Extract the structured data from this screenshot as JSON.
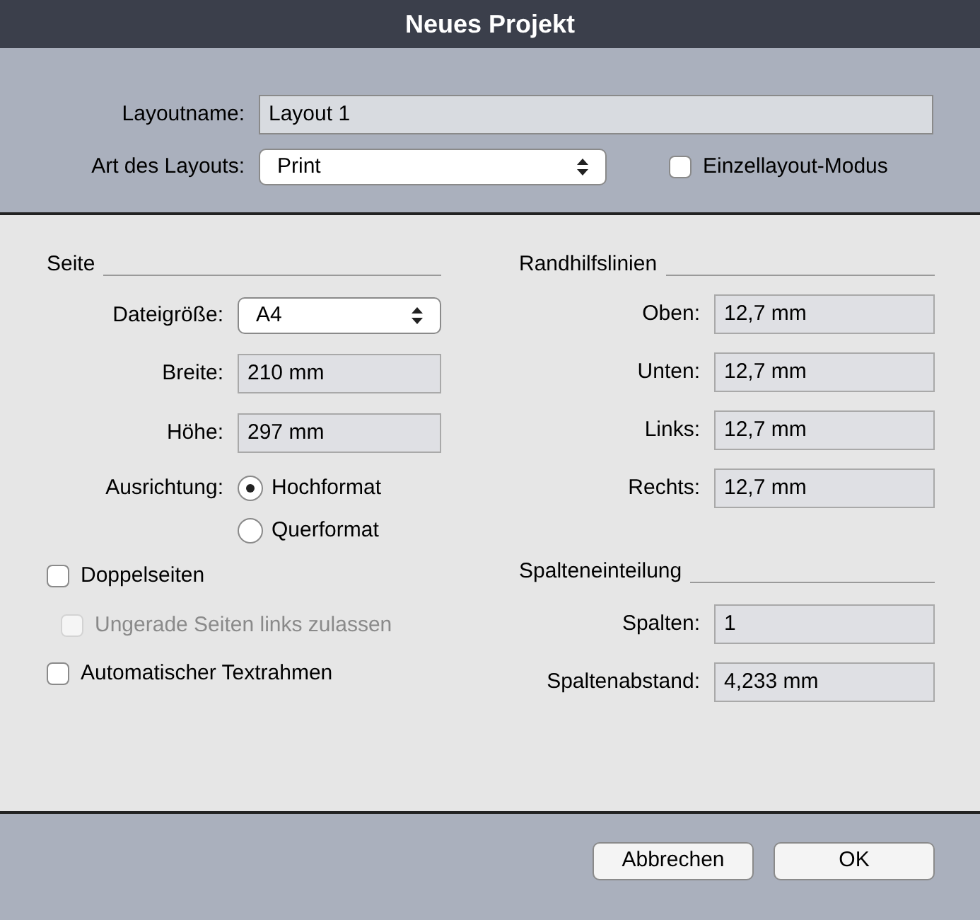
{
  "window": {
    "title": "Neues Projekt"
  },
  "top": {
    "layout_name": {
      "label": "Layoutname:",
      "value": "Layout 1"
    },
    "layout_type": {
      "label": "Art des Layouts:",
      "value": "Print"
    },
    "single_mode": {
      "label": "Einzellayout-Modus",
      "checked": false,
      "disabled": false
    }
  },
  "page": {
    "heading": "Seite",
    "size": {
      "label": "Dateigröße:",
      "value": "A4"
    },
    "fields": [
      {
        "label": "Breite:",
        "value": "210 mm"
      },
      {
        "label": "Höhe:",
        "value": "297 mm"
      }
    ],
    "orientation": {
      "label": "Ausrichtung:",
      "options": [
        {
          "label": "Hochformat",
          "selected": true
        },
        {
          "label": "Querformat",
          "selected": false
        }
      ]
    },
    "checkboxes": [
      {
        "label": "Doppelseiten",
        "checked": false,
        "disabled": false,
        "children": [
          {
            "label": "Ungerade Seiten links zulassen",
            "checked": false,
            "disabled": true
          }
        ]
      },
      {
        "label": "Automatischer Textrahmen",
        "checked": false,
        "disabled": false
      }
    ]
  },
  "margins": {
    "heading": "Randhilfslinien",
    "fields": [
      {
        "label": "Oben:",
        "value": "12,7 mm"
      },
      {
        "label": "Unten:",
        "value": "12,7 mm"
      },
      {
        "label": "Links:",
        "value": "12,7 mm"
      },
      {
        "label": "Rechts:",
        "value": "12,7 mm"
      }
    ]
  },
  "columns": {
    "heading": "Spalteneinteilung",
    "fields": [
      {
        "label": "Spalten:",
        "value": "1"
      },
      {
        "label": "Spaltenabstand:",
        "value": "4,233 mm"
      }
    ]
  },
  "buttons": [
    {
      "label": "Abbrechen"
    },
    {
      "label": "OK"
    }
  ]
}
